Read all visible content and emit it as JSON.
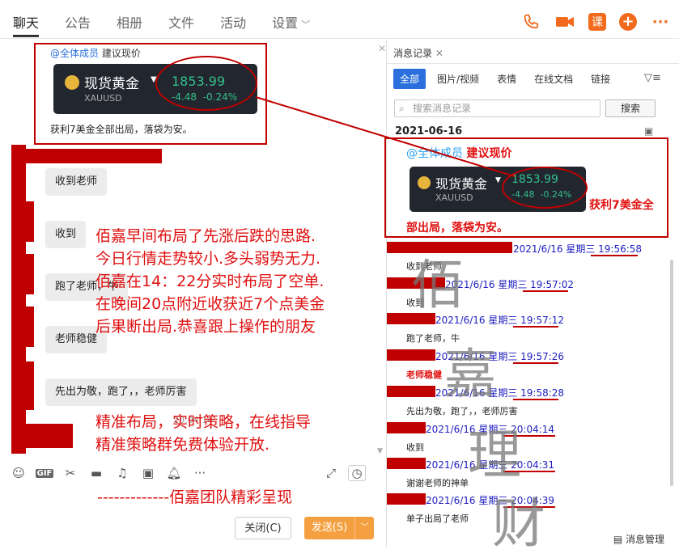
{
  "tabs": [
    "聊天",
    "公告",
    "相册",
    "文件",
    "活动",
    "设置"
  ],
  "quote": {
    "mention": "@全体成员",
    "text": "建议现价",
    "footer": "获利7美金全部出局，落袋为安。"
  },
  "gold": {
    "name": "现货黄金",
    "code": "XAUUSD",
    "price": "1853.99",
    "change": "-4.48",
    "pct": "-0.24%"
  },
  "bubbles": [
    "收到老师",
    "收到",
    "跑了老师，牛",
    "老师稳健",
    "先出为敬，跑了，，老师厉害"
  ],
  "time_partial": "20:04:14",
  "overlay": {
    "lines": [
      "佰嘉早间布局了先涨后跌的思路.",
      "今日行情走势较小.多头弱势无力.",
      "佰嘉在14：22分实时布局了空单.",
      "在晚间20点附近收获近7个点美金",
      "后果断出局.恭喜跟上操作的朋友"
    ],
    "strategy": [
      "精准布局，实时策略，在线指导",
      "精准策略群免费体验开放."
    ],
    "team": "-------------佰嘉团队精彩呈现"
  },
  "buttons": {
    "close": "关闭(C)",
    "send": "发送(S)"
  },
  "right": {
    "title": "消息记录",
    "filters": [
      "全部",
      "图片/视频",
      "表情",
      "在线文档",
      "链接"
    ],
    "search_placeholder": "搜索消息记录",
    "search_btn": "搜索",
    "date": "2021-06-16",
    "card_mention": "@全体成员",
    "card_text": "建议现价",
    "card_note1": "获利7美金全",
    "card_note2": "部出局，落袋为安。",
    "records": [
      {
        "time": "2021/6/16 星期三 19:56:58",
        "msg": "收到老师"
      },
      {
        "time": "2021/6/16 星期三 19:57:02",
        "msg": "收到"
      },
      {
        "time": "2021/6/16 星期三 19:57:12",
        "msg": "跑了老师，牛"
      },
      {
        "time": "2021/6/16 星期三 19:57:26",
        "msg": "老师稳健"
      },
      {
        "time": "2021/6/16 星期三 19:58:28",
        "msg": "先出为敬，跑了，，老师厉害"
      },
      {
        "time": "2021/6/16 星期三 20:04:14",
        "msg": "收到"
      },
      {
        "time": "2021/6/16 星期三 20:04:31",
        "msg": "谢谢老师的神单"
      },
      {
        "time": "2021/6/16 星期三 20:04:39",
        "msg": "单子出局了老师"
      }
    ],
    "footer": "消息管理",
    "watermark": [
      "佰",
      "嘉",
      "理",
      "财"
    ]
  },
  "colors": {
    "accent": "#f26b1d",
    "red": "#c00000",
    "blue": "#2a6fdb",
    "green": "#33c08a"
  }
}
